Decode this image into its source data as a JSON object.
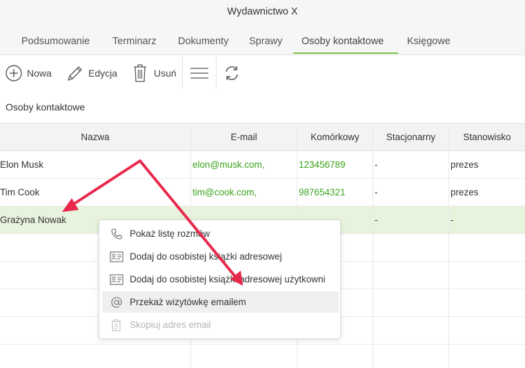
{
  "window": {
    "title": "Wydawnictwo X"
  },
  "tabs": [
    {
      "label": "Podsumowanie"
    },
    {
      "label": "Terminarz"
    },
    {
      "label": "Dokumenty"
    },
    {
      "label": "Sprawy"
    },
    {
      "label": "Osoby kontaktowe",
      "active": true
    },
    {
      "label": "Księgowe"
    }
  ],
  "toolbar": {
    "new_label": "Nowa",
    "edit_label": "Edycja",
    "delete_label": "Usuń"
  },
  "section": {
    "title": "Osoby kontaktowe"
  },
  "table": {
    "columns": [
      "Nazwa",
      "E-mail",
      "Komórkowy",
      "Stacjonarny",
      "Stanowisko"
    ],
    "rows": [
      {
        "name": "Elon Musk",
        "email": "elon@musk.com,",
        "mobile": "123456789",
        "landline": "-",
        "position": "prezes"
      },
      {
        "name": "Tim Cook",
        "email": "tim@cook.com,",
        "mobile": "987654321",
        "landline": "-",
        "position": "prezes"
      },
      {
        "name": "Grażyna Nowak",
        "email": "",
        "mobile": "",
        "landline": "-",
        "position": "-",
        "selected": true
      }
    ]
  },
  "context_menu": {
    "items": [
      {
        "label": "Pokaż listę rozmów",
        "icon": "phone-icon"
      },
      {
        "label": "Dodaj do osobistej książki adresowej",
        "icon": "contact-card-icon"
      },
      {
        "label": "Dodaj do osobistej książki adresowej użytkowni",
        "icon": "contact-card-icon"
      },
      {
        "label": "Przekaż wizytówkę emailem",
        "icon": "at-sign-icon",
        "hovered": true
      },
      {
        "label": "Skopiuj adres email",
        "icon": "copy-icon",
        "disabled": true
      }
    ]
  },
  "colors": {
    "accent": "#7bc142",
    "link_green": "#3aa31a",
    "selected_row": "#e7f3dc",
    "annotation_arrow": "#e8294c"
  }
}
